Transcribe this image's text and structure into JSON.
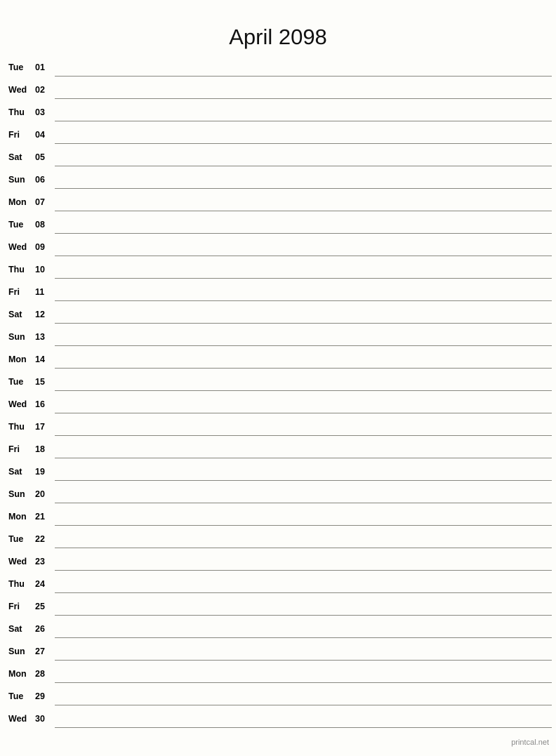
{
  "document": {
    "title": "April 2098",
    "month": "April",
    "year": "2098"
  },
  "footer": {
    "credit": "printcal.net"
  },
  "colors": {
    "background": "#fdfdfa",
    "text": "#000000",
    "rule_line": "#888880",
    "footer_text": "#8a8a8a"
  },
  "days": [
    {
      "weekday": "Tue",
      "date": "01"
    },
    {
      "weekday": "Wed",
      "date": "02"
    },
    {
      "weekday": "Thu",
      "date": "03"
    },
    {
      "weekday": "Fri",
      "date": "04"
    },
    {
      "weekday": "Sat",
      "date": "05"
    },
    {
      "weekday": "Sun",
      "date": "06"
    },
    {
      "weekday": "Mon",
      "date": "07"
    },
    {
      "weekday": "Tue",
      "date": "08"
    },
    {
      "weekday": "Wed",
      "date": "09"
    },
    {
      "weekday": "Thu",
      "date": "10"
    },
    {
      "weekday": "Fri",
      "date": "11"
    },
    {
      "weekday": "Sat",
      "date": "12"
    },
    {
      "weekday": "Sun",
      "date": "13"
    },
    {
      "weekday": "Mon",
      "date": "14"
    },
    {
      "weekday": "Tue",
      "date": "15"
    },
    {
      "weekday": "Wed",
      "date": "16"
    },
    {
      "weekday": "Thu",
      "date": "17"
    },
    {
      "weekday": "Fri",
      "date": "18"
    },
    {
      "weekday": "Sat",
      "date": "19"
    },
    {
      "weekday": "Sun",
      "date": "20"
    },
    {
      "weekday": "Mon",
      "date": "21"
    },
    {
      "weekday": "Tue",
      "date": "22"
    },
    {
      "weekday": "Wed",
      "date": "23"
    },
    {
      "weekday": "Thu",
      "date": "24"
    },
    {
      "weekday": "Fri",
      "date": "25"
    },
    {
      "weekday": "Sat",
      "date": "26"
    },
    {
      "weekday": "Sun",
      "date": "27"
    },
    {
      "weekday": "Mon",
      "date": "28"
    },
    {
      "weekday": "Tue",
      "date": "29"
    },
    {
      "weekday": "Wed",
      "date": "30"
    }
  ]
}
